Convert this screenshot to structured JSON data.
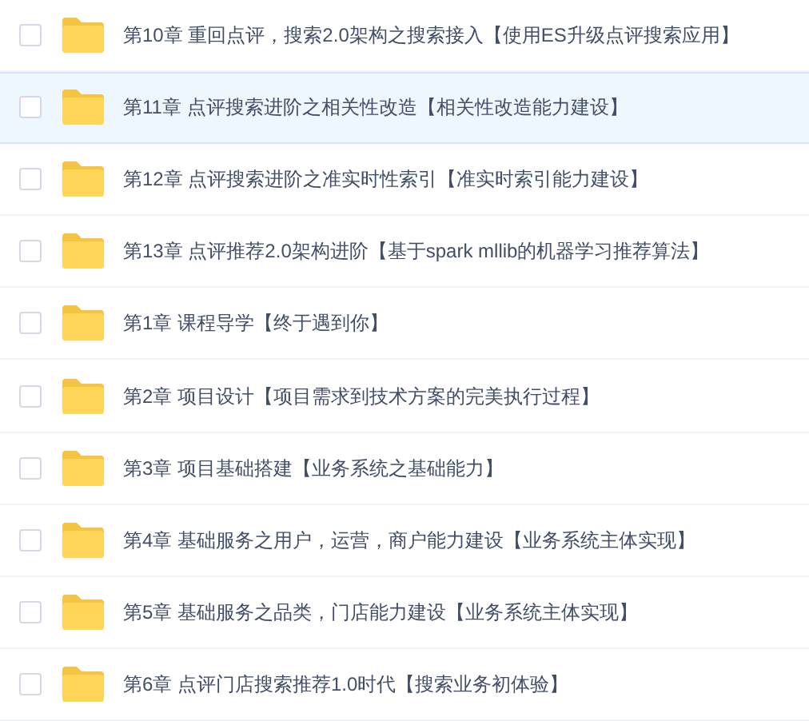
{
  "files": [
    {
      "name": "第10章 重回点评，搜索2.0架构之搜索接入【使用ES升级点评搜索应用】",
      "checked": false,
      "highlighted": false
    },
    {
      "name": "第11章 点评搜索进阶之相关性改造【相关性改造能力建设】",
      "checked": false,
      "highlighted": true
    },
    {
      "name": "第12章 点评搜索进阶之准实时性索引【准实时索引能力建设】",
      "checked": false,
      "highlighted": false
    },
    {
      "name": "第13章 点评推荐2.0架构进阶【基于spark mllib的机器学习推荐算法】",
      "checked": false,
      "highlighted": false
    },
    {
      "name": "第1章 课程导学【终于遇到你】",
      "checked": false,
      "highlighted": false
    },
    {
      "name": "第2章 项目设计【项目需求到技术方案的完美执行过程】",
      "checked": false,
      "highlighted": false
    },
    {
      "name": "第3章 项目基础搭建【业务系统之基础能力】",
      "checked": false,
      "highlighted": false
    },
    {
      "name": "第4章 基础服务之用户，运营，商户能力建设【业务系统主体实现】",
      "checked": false,
      "highlighted": false
    },
    {
      "name": "第5章 基础服务之品类，门店能力建设【业务系统主体实现】",
      "checked": false,
      "highlighted": false
    },
    {
      "name": "第6章 点评门店搜索推荐1.0时代【搜索业务初体验】",
      "checked": false,
      "highlighted": false
    }
  ]
}
